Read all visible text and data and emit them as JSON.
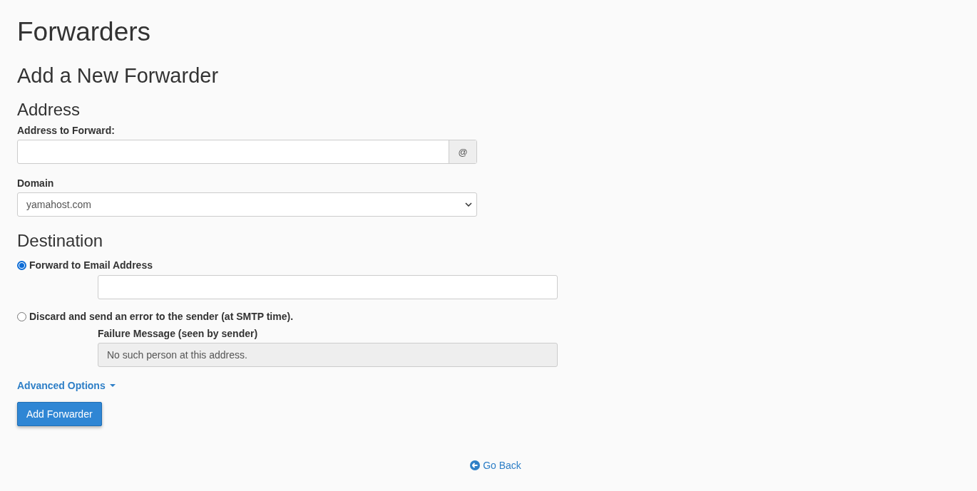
{
  "page_title": "Forwarders",
  "heading": "Add a New Forwarder",
  "address": {
    "title": "Address",
    "forward_label": "Address to Forward:",
    "at_sign": "@",
    "domain_label": "Domain",
    "domain_value": "yamahost.com"
  },
  "destination": {
    "title": "Destination",
    "options": [
      {
        "kind": "email",
        "label": "Forward to Email Address",
        "selected": true
      },
      {
        "kind": "discard",
        "label": "Discard and send an error to the sender (at SMTP time).",
        "selected": false,
        "message_label": "Failure Message (seen by sender)",
        "message_value": "No such person at this address.",
        "disabled": true
      }
    ]
  },
  "advanced": {
    "label": "Advanced Options",
    "expanded": false
  },
  "submit": "Add Forwarder",
  "go_back": "Go Back"
}
